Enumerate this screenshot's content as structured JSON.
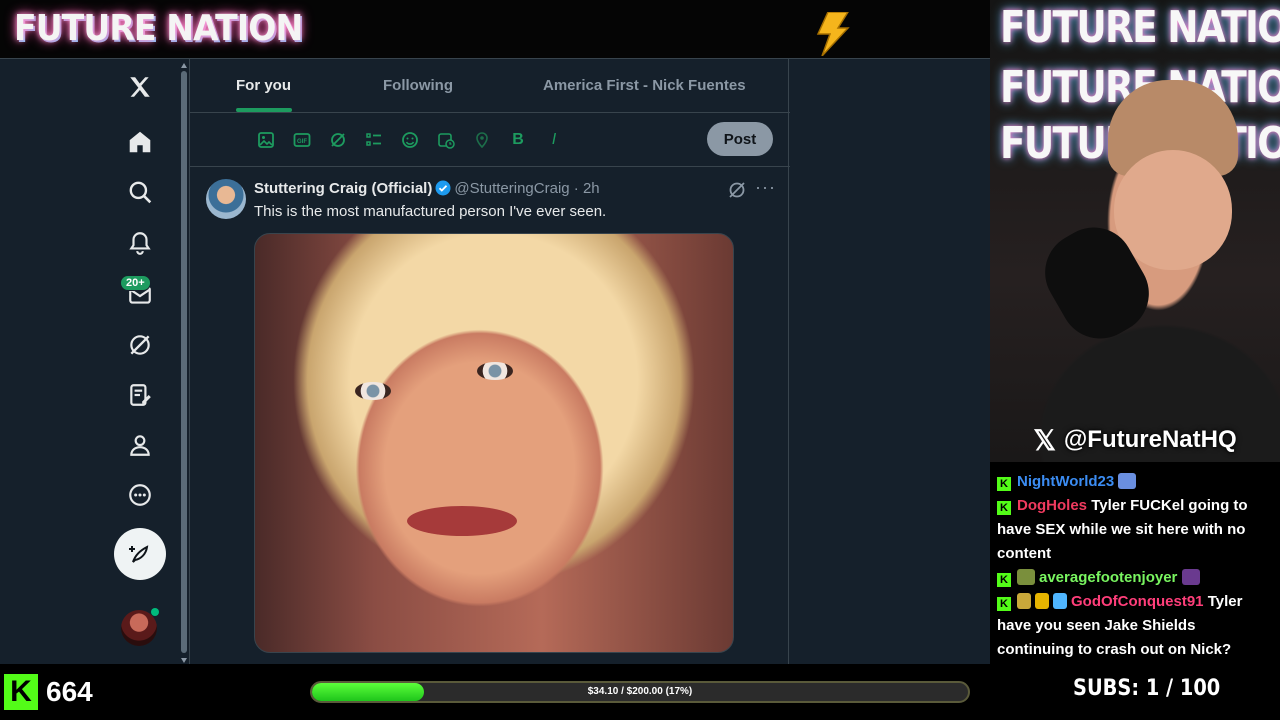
{
  "stream": {
    "brand": "FUTURE NATION",
    "webcam_overlay": [
      "FUTURE NATION",
      "FUTURE NATION",
      "FUTURE NATION"
    ],
    "x_handle": "@FutureNatHQ",
    "x_logo": "𝕏"
  },
  "x": {
    "nav": [
      {
        "icon": "x-logo-icon"
      },
      {
        "icon": "home-icon"
      },
      {
        "icon": "search-icon"
      },
      {
        "icon": "notifications-icon"
      },
      {
        "icon": "messages-icon"
      },
      {
        "icon": "grok-icon"
      },
      {
        "icon": "lists-icon"
      },
      {
        "icon": "profile-icon"
      },
      {
        "icon": "more-icon"
      }
    ],
    "messages_badge": "20+",
    "tabs": [
      {
        "label": "For you",
        "active": true
      },
      {
        "label": "Following",
        "active": false
      },
      {
        "label": "America First - Nick Fuentes",
        "active": false
      }
    ],
    "composer_tools": [
      "image-icon",
      "gif-icon",
      "grok-icon",
      "poll-icon",
      "emoji-icon",
      "schedule-icon",
      "location-icon",
      "bold-icon",
      "italic-icon"
    ],
    "bold_glyph": "B",
    "italic_glyph": "I",
    "post_label": "Post",
    "tweet": {
      "name": "Stuttering Craig (Official)",
      "handle": "@StutteringCraig",
      "time": "· 2h",
      "text": "This is the most manufactured person I've ever seen.",
      "more": "···"
    },
    "accent_color": "#1d9b5f"
  },
  "chat": {
    "messages": [
      {
        "user": "NightWorld23",
        "text": ""
      },
      {
        "user": "DogHoles",
        "text": "Tyler FUCKel going to have SEX while we sit here with no content"
      },
      {
        "user": "averagefootenjoyer",
        "text": ""
      },
      {
        "user": "GodOfConquest91",
        "text": "Tyler have you seen Jake Shields continuing to crash out on Nick?"
      }
    ]
  },
  "bottom": {
    "kick_logo": "K",
    "viewers": "664",
    "goal_text": "$34.10 / $200.00 (17%)",
    "goal_progress": 0.17,
    "subs": "SUBS:  1 / 100"
  }
}
